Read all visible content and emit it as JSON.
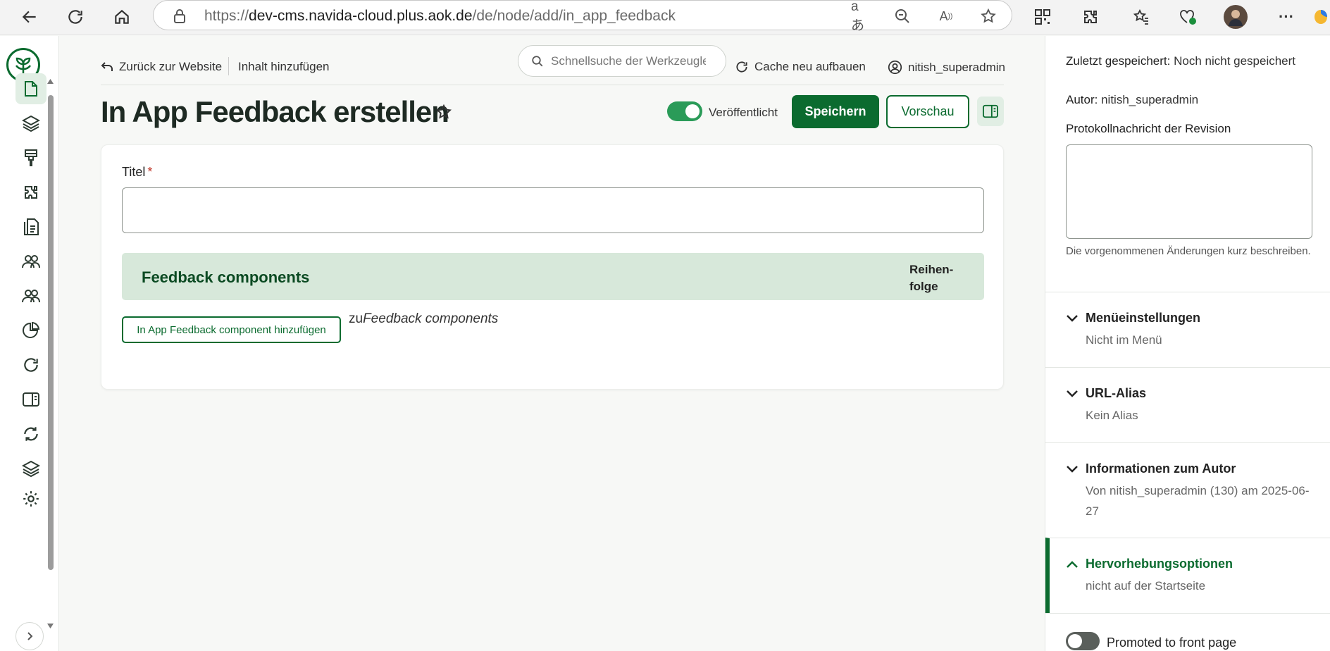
{
  "browser": {
    "url_prefix": "https://",
    "url_host": "dev-cms.navida-cloud.plus.aok.de",
    "url_path": "/de/node/add/in_app_feedback"
  },
  "topnav": {
    "back_label": "Zurück zur Website",
    "add_content_label": "Inhalt hinzufügen",
    "search_placeholder": "Schnellsuche der Werkzeugleiste",
    "cache_label": "Cache neu aufbauen",
    "user_label": "nitish_superadmin"
  },
  "header": {
    "title": "In App Feedback erstellen",
    "published_label": "Veröffentlicht",
    "published": true,
    "save_label": "Speichern",
    "preview_label": "Vorschau"
  },
  "form": {
    "title_label": "Titel",
    "required_mark": "*",
    "title_value": "",
    "components_title": "Feedback components",
    "order_label": "Reihen-\nfolge",
    "add_component_label": "In App Feedback component hinzufügen",
    "add_component_prefix": "zu",
    "add_component_target": "Feedback components"
  },
  "sidebar": {
    "last_saved_key": "Zuletzt gespeichert:",
    "last_saved_value": "Noch nicht gespeichert",
    "author_key": "Autor:",
    "author_value": "nitish_superadmin",
    "revision_label": "Protokollnachricht der Revision",
    "revision_value": "",
    "revision_help": "Die vorgenommenen Änderungen kurz beschreiben.",
    "sections": [
      {
        "title": "Menüeinstellungen",
        "summary": "Nicht im Menü",
        "open": false
      },
      {
        "title": "URL-Alias",
        "summary": "Kein Alias",
        "open": false
      },
      {
        "title": "Informationen zum Autor",
        "summary": "Von nitish_superadmin (130) am 2025-06-27",
        "open": false
      },
      {
        "title": "Hervorhebungsoptionen",
        "summary": "nicht auf der Startseite",
        "open": true
      }
    ],
    "promoted_label": "Promoted to front page",
    "promoted": false
  },
  "colors": {
    "brand_green": "#0b6b2f",
    "toggle_on": "#2a9b58",
    "components_header_bg": "#d7e8da"
  }
}
